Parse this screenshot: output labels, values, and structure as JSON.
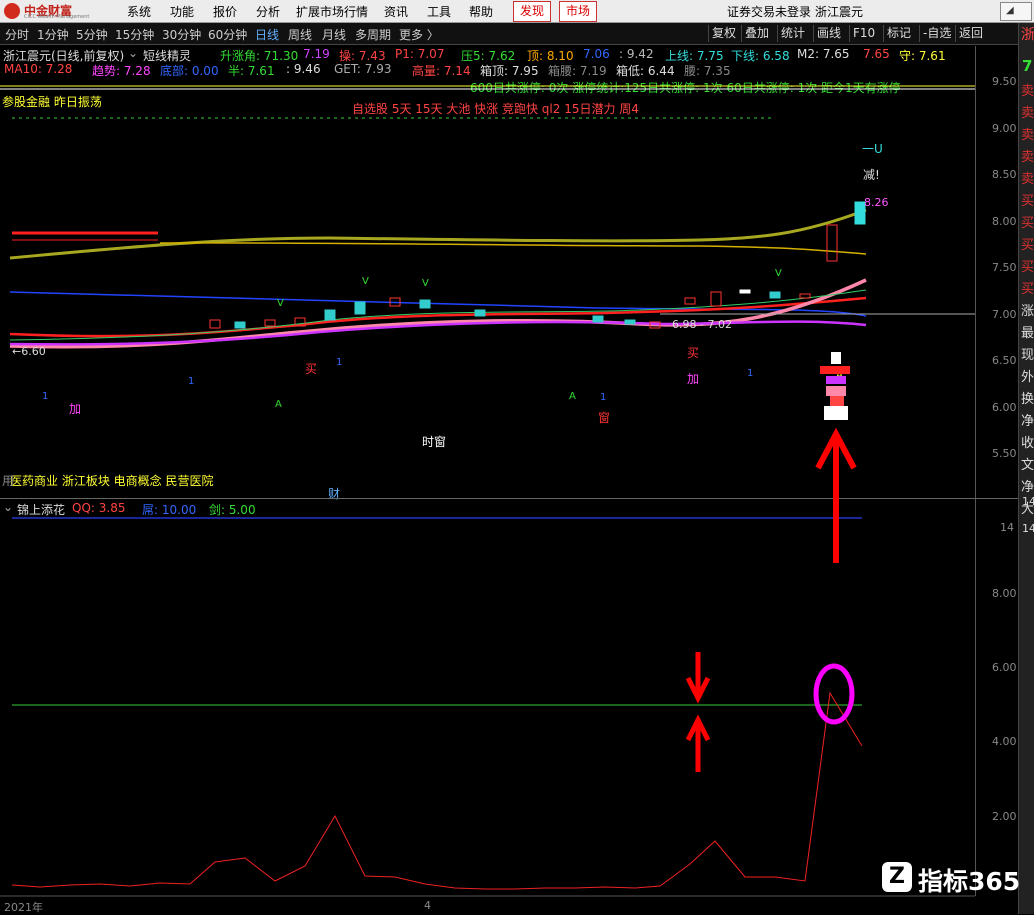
{
  "menu_bar": {
    "logo_text": "中金财富",
    "logo_subtext": "CICC Wealth Management",
    "items": [
      "系统",
      "功能",
      "报价",
      "分析",
      "扩展市场行情",
      "资讯",
      "工具",
      "帮助"
    ],
    "tab_discover": "发现",
    "tab_market": "市场",
    "status_text": "证券交易未登录",
    "stock_name": "浙江震元"
  },
  "period_toolbar": {
    "periods": [
      "分时",
      "1分钟",
      "5分钟",
      "15分钟",
      "30分钟",
      "60分钟",
      "日线",
      "周线",
      "月线",
      "多周期",
      "更多 〉"
    ],
    "active_period": "日线",
    "right_buttons": [
      "复权",
      "叠加",
      "统计",
      "画线",
      "F10",
      "标记",
      "-自选",
      "返回"
    ]
  },
  "main_chart": {
    "title": "浙江震元(日线,前复权)",
    "indicator_name": "短线精灵",
    "row1": [
      {
        "label": "升涨角:",
        "value": "71.30",
        "color": "#33dd33"
      },
      {
        "label": "",
        "value": "7.19",
        "color": "#cc44ff"
      },
      {
        "label": "操:",
        "value": "7.43",
        "color": "#ff4444"
      },
      {
        "label": "P1:",
        "value": "7.07",
        "color": "#ff4444"
      },
      {
        "label": "压5:",
        "value": "7.62",
        "color": "#33dd33"
      },
      {
        "label": "顶:",
        "value": "8.10",
        "color": "#ffaa00"
      },
      {
        "label": "",
        "value": "7.06",
        "color": "#3366ff"
      },
      {
        "label": ":",
        "value": "9.42",
        "color": "#bbbbbb"
      },
      {
        "label": "上线:",
        "value": "7.75",
        "color": "#33dddd"
      },
      {
        "label": "下线:",
        "value": "6.58",
        "color": "#33dddd"
      },
      {
        "label": "M2:",
        "value": "7.65",
        "color": "#dddddd"
      },
      {
        "label": "",
        "value": "7.65",
        "color": "#ff4444"
      },
      {
        "label": "守:",
        "value": "7.61",
        "color": "#ffff33"
      }
    ],
    "row2": [
      {
        "label": "MA10:",
        "value": "7.28",
        "color": "#ff4444"
      },
      {
        "label": "趋势:",
        "value": "7.28",
        "color": "#ff44ff"
      },
      {
        "label": "底部:",
        "value": "0.00",
        "color": "#3366ff"
      },
      {
        "label": "半:",
        "value": "7.61",
        "color": "#33dd33"
      },
      {
        "label": ":",
        "value": "9.46",
        "color": "#dddddd"
      },
      {
        "label": "GET:",
        "value": "7.93",
        "color": "#aaaaaa"
      },
      {
        "label": "高量:",
        "value": "7.14",
        "color": "#ff4444"
      },
      {
        "label": "箱顶:",
        "value": "7.95",
        "color": "#dddddd"
      },
      {
        "label": "箱腰:",
        "value": "7.19",
        "color": "#888888"
      },
      {
        "label": "箱低:",
        "value": "6.44",
        "color": "#dddddd"
      },
      {
        "label": "腰:",
        "value": "7.35",
        "color": "#888888"
      }
    ],
    "row3": "600日共涨停: 0次    涨停统计:125日共涨停: 1次    60日共涨停: 1次    距今1天有涨停",
    "sector_tag": "参股金融 昨日振荡",
    "screen_tags": "自选股 5天 15天 大池 快涨 竞跑快 ql2 15日潜力 周4",
    "concepts": "医药商业 浙江板块 电商概念 民营医院",
    "y_labels": [
      "9.50",
      "9.00",
      "8.50",
      "8.00",
      "7.50",
      "7.00",
      "6.50",
      "6.00",
      "5.50"
    ],
    "low_label": "6.60",
    "range_label": "6.98 - 7.02",
    "price_tag": "8.26",
    "signals": {
      "buy": "买",
      "add": "加",
      "window": "窗",
      "time_window": "时窗",
      "wealth": "财",
      "reduce": "减!",
      "arrow_u": "一U",
      "a": "A",
      "v": "V",
      "one": "1"
    }
  },
  "sub_chart": {
    "name": "锦上添花",
    "values": [
      {
        "label": "QQ:",
        "value": "3.85",
        "color": "#ff4444"
      },
      {
        "label": "屌:",
        "value": "10.00",
        "color": "#3366ff"
      },
      {
        "label": "剑:",
        "value": "5.00",
        "color": "#33dd33"
      }
    ],
    "y_labels": [
      "14",
      "8.00",
      "6.00",
      "4.00",
      "2.00"
    ]
  },
  "x_axis": {
    "year_label": "2021年",
    "month_label": "4"
  },
  "side_panel": {
    "stock_code_prefix": "浙",
    "price_digit": "7",
    "chars": [
      "卖",
      "卖",
      "卖",
      "卖",
      "卖",
      "买",
      "买",
      "买",
      "买",
      "买",
      "涨",
      "最",
      "现",
      "外",
      "换",
      "净",
      "收",
      "文",
      "净",
      "大"
    ],
    "sub_labels": [
      "14",
      "14"
    ]
  },
  "watermark": "指标365",
  "colors": {
    "bg": "#000000",
    "up": "#ff3333",
    "down": "#33cccc",
    "ma_pink": "#ff88aa",
    "ma_purple": "#cc33ff",
    "ma_olive": "#a8a820",
    "annot_red": "#ff0000",
    "annot_magenta": "#ff00ff"
  }
}
